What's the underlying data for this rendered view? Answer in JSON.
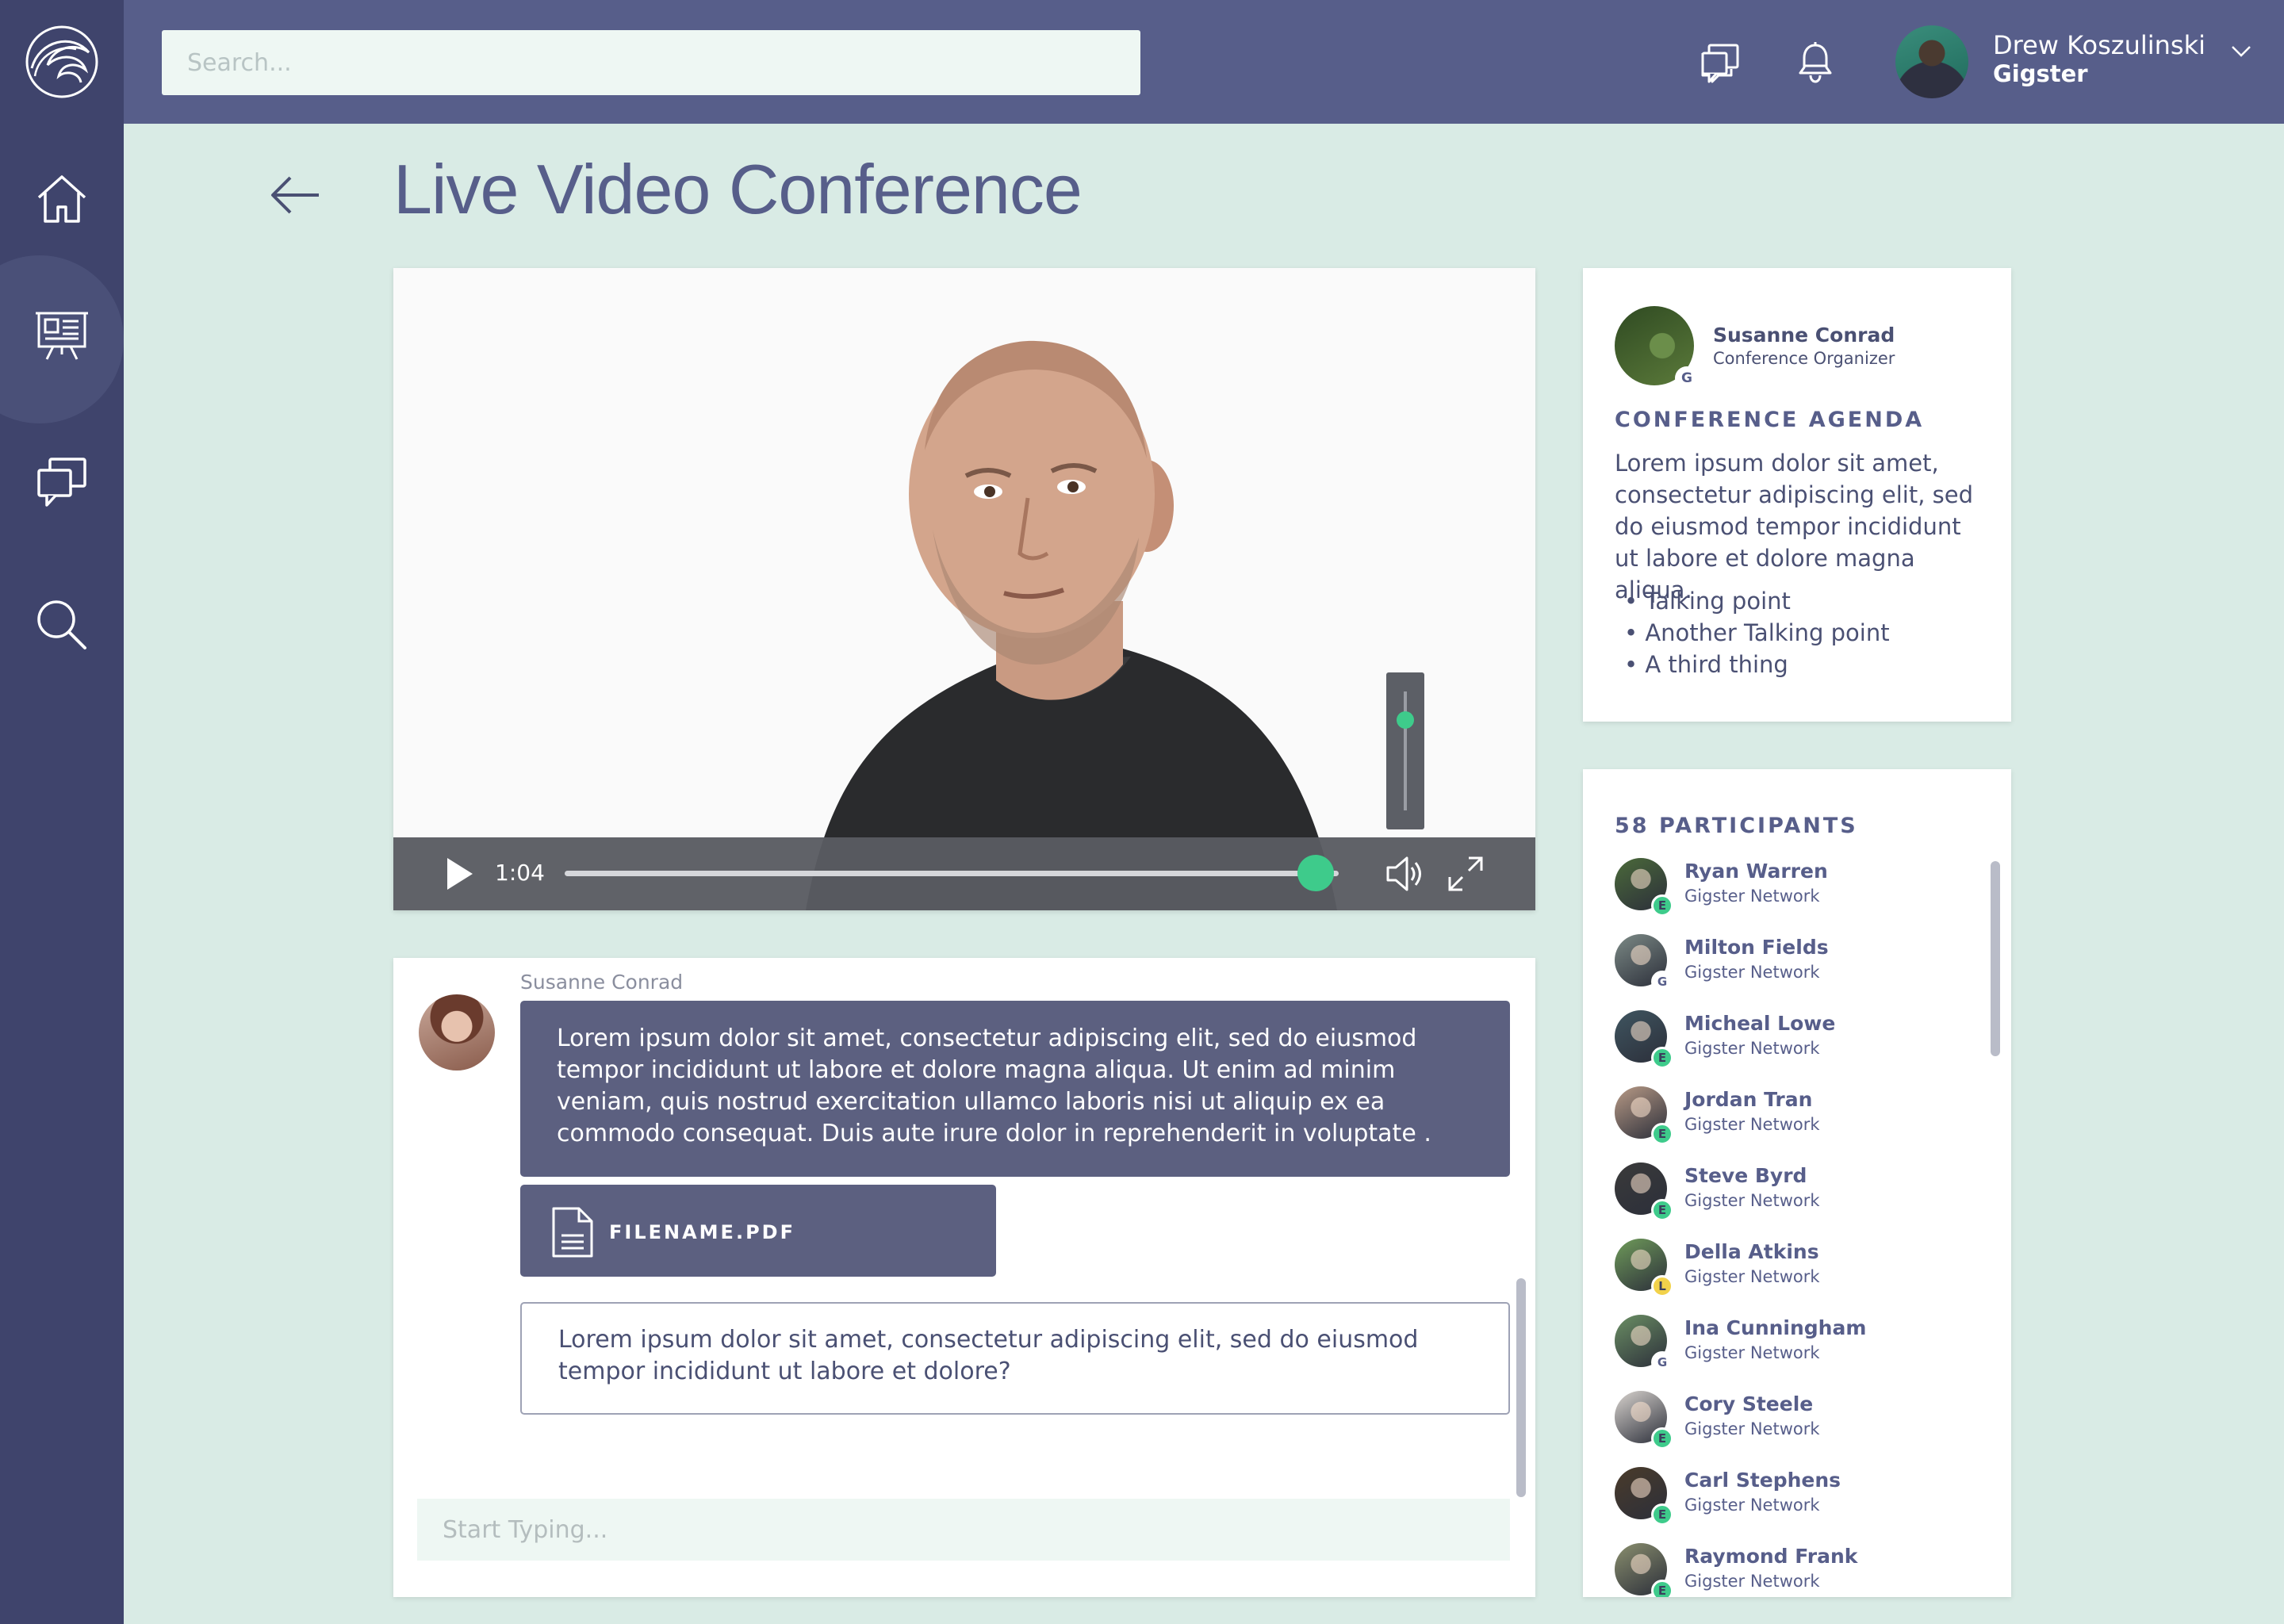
{
  "header": {
    "search_placeholder": "Search...",
    "user": {
      "name": "Drew Koszulinski",
      "role": "Gigster"
    }
  },
  "sidebar": {
    "items": [
      {
        "icon": "home-icon",
        "active": false
      },
      {
        "icon": "presentation-icon",
        "active": true
      },
      {
        "icon": "chat-icon",
        "active": false
      },
      {
        "icon": "search-icon",
        "active": false
      }
    ]
  },
  "page": {
    "title": "Live Video Conference"
  },
  "video": {
    "time": "1:04",
    "progress": 0.97,
    "volume": 0.76
  },
  "chat": {
    "sender": "Susanne Conrad",
    "message": "Lorem ipsum dolor sit amet, consectetur adipiscing elit, sed do eiusmod tempor incididunt ut labore et dolore magna aliqua. Ut enim ad minim veniam, quis nostrud exercitation ullamco laboris nisi ut aliquip ex ea commodo consequat. Duis aute irure dolor in reprehenderit in voluptate .",
    "file_name": "FILENAME.PDF",
    "reply": "Lorem ipsum dolor sit amet, consectetur adipiscing elit, sed do eiusmod tempor incididunt ut labore et dolore?",
    "input_placeholder": "Start Typing..."
  },
  "agenda": {
    "organizer_name": "Susanne Conrad",
    "organizer_role": "Conference Organizer",
    "organizer_badge": "G",
    "heading": "CONFERENCE AGENDA",
    "text": "Lorem ipsum dolor sit amet, consectetur adipiscing elit, sed do eiusmod tempor incididunt ut labore et dolore magna aliqua.",
    "points": [
      "Talking point",
      "Another Talking point",
      "A third thing"
    ]
  },
  "participants": {
    "heading": "58 PARTICIPANTS",
    "list": [
      {
        "name": "Ryan Warren",
        "network": "Gigster Network",
        "badge": "E",
        "badge_color": "#3ecb8b",
        "avatar_color": "#4b6a3a"
      },
      {
        "name": "Milton Fields",
        "network": "Gigster Network",
        "badge": "G",
        "badge_color": "#ffffff",
        "avatar_color": "#7c8a86"
      },
      {
        "name": "Micheal Lowe",
        "network": "Gigster Network",
        "badge": "E",
        "badge_color": "#3ecb8b",
        "avatar_color": "#3f5560"
      },
      {
        "name": "Jordan Tran",
        "network": "Gigster Network",
        "badge": "E",
        "badge_color": "#3ecb8b",
        "avatar_color": "#b89a86"
      },
      {
        "name": "Steve Byrd",
        "network": "Gigster Network",
        "badge": "E",
        "badge_color": "#3ecb8b",
        "avatar_color": "#3a3a3a"
      },
      {
        "name": "Della Atkins",
        "network": "Gigster Network",
        "badge": "L",
        "badge_color": "#f2d24a",
        "avatar_color": "#6f9b5a"
      },
      {
        "name": "Ina Cunningham",
        "network": "Gigster Network",
        "badge": "G",
        "badge_color": "#ffffff",
        "avatar_color": "#6b8f64"
      },
      {
        "name": "Cory Steele",
        "network": "Gigster Network",
        "badge": "E",
        "badge_color": "#3ecb8b",
        "avatar_color": "#d9d4cf"
      },
      {
        "name": "Carl Stephens",
        "network": "Gigster Network",
        "badge": "E",
        "badge_color": "#3ecb8b",
        "avatar_color": "#4a3b2a"
      },
      {
        "name": "Raymond Frank",
        "network": "Gigster Network",
        "badge": "E",
        "badge_color": "#3ecb8b",
        "avatar_color": "#8a8f6e"
      }
    ]
  },
  "colors": {
    "accent": "#3ecb8b",
    "header_bg": "#575e8a",
    "sidebar_bg": "#3f446c",
    "page_bg": "#d9ebe5",
    "bubble": "#5c6080"
  }
}
